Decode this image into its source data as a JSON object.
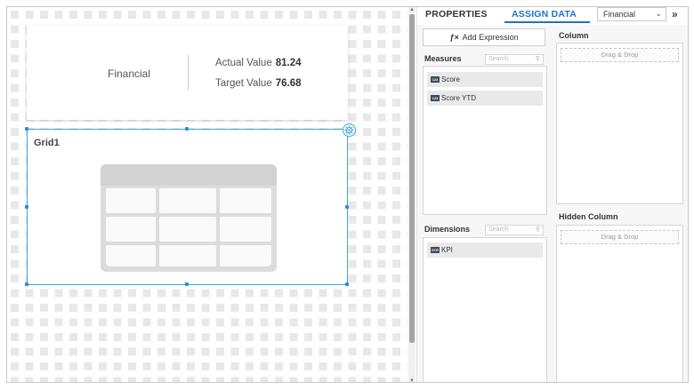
{
  "canvas": {
    "kpi_widget": {
      "title": "Financial",
      "actual_label": "Actual Value",
      "actual_value": "81.24",
      "target_label": "Target Value",
      "target_value": "76.68"
    },
    "grid_widget": {
      "title": "Grid1"
    }
  },
  "panel": {
    "tabs": {
      "properties": "PROPERTIES",
      "assign_data": "ASSIGN DATA"
    },
    "datasource_select": "Financial",
    "add_expression": "Add Expression",
    "measures": {
      "label": "Measures",
      "search_placeholder": "Search",
      "items": [
        {
          "type": "123",
          "label": "Score"
        },
        {
          "type": "123",
          "label": "Score YTD"
        }
      ]
    },
    "dimensions": {
      "label": "Dimensions",
      "search_placeholder": "Search",
      "items": [
        {
          "type": "STR",
          "label": "KPI"
        }
      ]
    },
    "column": {
      "label": "Column",
      "drop_text": "Drag & Drop"
    },
    "hidden_column": {
      "label": "Hidden Column",
      "drop_text": "Drag & Drop"
    }
  },
  "colors": {
    "accent": "#1f73c4",
    "selection": "#3fa2dd"
  }
}
